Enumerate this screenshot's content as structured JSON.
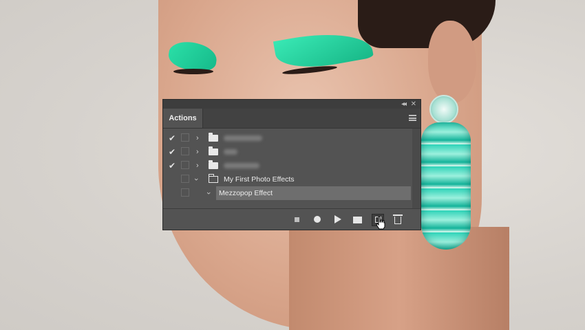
{
  "panel": {
    "tab_label": "Actions",
    "icons": {
      "collapse": "double-chevron-left-icon",
      "close": "close-icon",
      "menu": "hamburger-menu-icon"
    },
    "rows": [
      {
        "checked": true,
        "expanded": false,
        "type": "set",
        "label_blurred": true
      },
      {
        "checked": true,
        "expanded": false,
        "type": "set",
        "label_blurred": true
      },
      {
        "checked": true,
        "expanded": false,
        "type": "set",
        "label_blurred": true
      },
      {
        "checked": false,
        "expanded": true,
        "type": "set",
        "label": "My First Photo Effects"
      },
      {
        "checked": false,
        "expanded": true,
        "type": "action",
        "label": "Mezzopop Effect",
        "selected": true
      }
    ],
    "toolbar": [
      "stop-icon",
      "record-icon",
      "play-icon",
      "new-set-folder-icon",
      "new-action-icon",
      "trash-icon"
    ],
    "colors": {
      "panel_bg": "#535353",
      "selection": "#6e6e6e",
      "eyeshadow": "#2be0a8"
    }
  }
}
